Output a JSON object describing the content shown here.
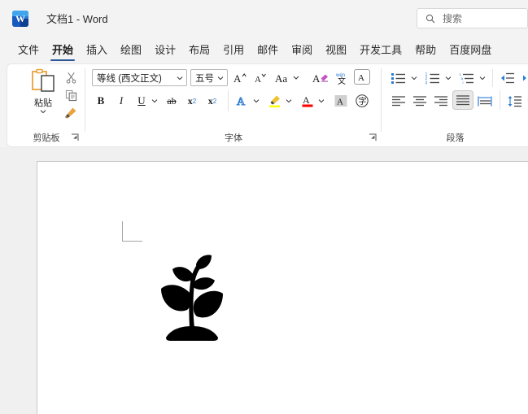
{
  "window": {
    "app_icon": "word-icon",
    "title": "文档1  -  Word"
  },
  "search": {
    "icon": "search-icon",
    "placeholder": "搜索"
  },
  "tabs": [
    {
      "label": "文件",
      "active": false
    },
    {
      "label": "开始",
      "active": true
    },
    {
      "label": "插入",
      "active": false
    },
    {
      "label": "绘图",
      "active": false
    },
    {
      "label": "设计",
      "active": false
    },
    {
      "label": "布局",
      "active": false
    },
    {
      "label": "引用",
      "active": false
    },
    {
      "label": "邮件",
      "active": false
    },
    {
      "label": "审阅",
      "active": false
    },
    {
      "label": "视图",
      "active": false
    },
    {
      "label": "开发工具",
      "active": false
    },
    {
      "label": "帮助",
      "active": false
    },
    {
      "label": "百度网盘",
      "active": false
    }
  ],
  "ribbon": {
    "clipboard": {
      "group_label": "剪贴板",
      "paste_label": "粘贴",
      "paste_icon": "paste-clipboard-icon",
      "cut_icon": "scissors-cut-icon",
      "copy_icon": "copy-pages-icon",
      "format_painter_icon": "format-painter-brush-icon",
      "launcher_icon": "dialog-launcher-icon"
    },
    "font": {
      "group_label": "字体",
      "font_name": "等线 (西文正文)",
      "font_size": "五号",
      "grow_font_icon": "grow-font-icon",
      "shrink_font_icon": "shrink-font-icon",
      "change_case_label": "Aa",
      "change_case_icon": "change-case-icon",
      "clear_format_icon": "clear-formatting-icon",
      "phonetic_icon": "phonetic-guide-icon",
      "char_border_icon": "character-border-icon",
      "bold_label": "B",
      "italic_label": "I",
      "underline_label": "U",
      "strikethrough_label": "ab",
      "subscript_label": "x",
      "subscript_sub": "2",
      "superscript_label": "x",
      "superscript_sup": "2",
      "text_effects_label": "A",
      "text_effects_icon": "text-effects-icon",
      "highlight_label": "highlight-pen-icon",
      "font_color_label": "A",
      "font_color_icon": "font-color-icon",
      "shading_label": "A",
      "shading_icon": "character-shading-icon",
      "enclose_char_label": "字",
      "enclose_char_icon": "enclose-character-icon",
      "launcher_icon": "dialog-launcher-icon",
      "colors": {
        "highlight": "#ffff00",
        "font_color": "#ff0000",
        "text_effects": "#2b7cd3"
      }
    },
    "paragraph": {
      "group_label": "段落",
      "bullets_icon": "bullet-list-icon",
      "numbering_icon": "numbered-list-icon",
      "multilevel_icon": "multilevel-list-icon",
      "decrease_indent_icon": "decrease-indent-icon",
      "increase_indent_icon": "increase-indent-icon",
      "align_left_icon": "align-left-icon",
      "align_center_icon": "align-center-icon",
      "align_right_icon": "align-right-icon",
      "justify_icon": "justify-icon",
      "distribute_icon": "distribute-text-icon",
      "line_spacing_icon": "line-spacing-icon",
      "active_alignment": "justify"
    }
  },
  "document": {
    "page_content_icon": "plant-seedling-graphic",
    "margin_marker": "margin-corner-marker"
  },
  "colors": {
    "accent": "#2b579a",
    "ribbon_bg": "#ffffff",
    "chrome_bg": "#f3f3f3",
    "canvas_bg": "#f0f0f0",
    "page_bg": "#ffffff",
    "paste_orange": "#e8a33d"
  }
}
